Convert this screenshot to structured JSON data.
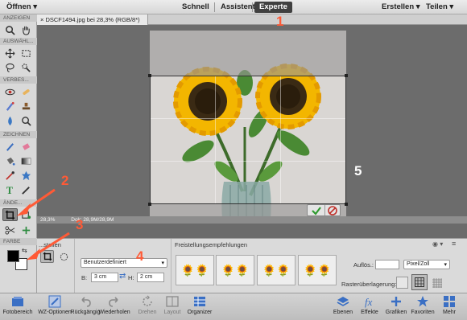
{
  "topbar": {
    "open_label": "Öffnen",
    "modes": [
      "Schnell",
      "Assistent",
      "Experte"
    ],
    "create_label": "Erstellen",
    "share_label": "Teilen"
  },
  "document": {
    "tab_title": "DSCF1494.jpg bei 28,3% (RGB/8*)",
    "zoom": "28,3%",
    "doc_size": "Dok: 28,9M/28,9M"
  },
  "tools_panel": {
    "sections": [
      "ANZEIGEN",
      "AUSWÄHL...",
      "VERBES...",
      "ZEICHNEN",
      "ÄNDE...",
      "FARBE"
    ]
  },
  "options": {
    "mode_label": "...stellen",
    "preset_select": "Benutzerdefiniert",
    "width_label": "B:",
    "width_value": "3 cm",
    "height_label": "H:",
    "height_value": "2 cm",
    "suggestions_title": "Freistellungsempfehlungen",
    "resolution_label": "Auflös.:",
    "resolution_value": "",
    "unit_select": "Pixel/Zoll",
    "grid_overlay_label": "Rasterüberlagerung:"
  },
  "bottombar": {
    "items": [
      {
        "label": "Fotobereich",
        "icon": "photo-bin-icon"
      },
      {
        "label": "WZ-Optionen",
        "icon": "tool-options-icon"
      },
      {
        "label": "Rückgängig",
        "icon": "undo-icon"
      },
      {
        "label": "Wiederholen",
        "icon": "redo-icon"
      },
      {
        "label": "Drehen",
        "icon": "rotate-icon"
      },
      {
        "label": "Layout",
        "icon": "layout-icon"
      },
      {
        "label": "Organizer",
        "icon": "organizer-icon"
      },
      {
        "label": "Ebenen",
        "icon": "layers-icon"
      },
      {
        "label": "Effekte",
        "icon": "effects-icon"
      },
      {
        "label": "Grafiken",
        "icon": "graphics-icon"
      },
      {
        "label": "Favoriten",
        "icon": "favorites-icon"
      },
      {
        "label": "Mehr",
        "icon": "more-icon"
      }
    ]
  },
  "annotations": [
    "1",
    "2",
    "3",
    "4",
    "5"
  ],
  "colors": {
    "accent_arrow": "#ff5a36",
    "active_mode_bg": "#404040"
  }
}
